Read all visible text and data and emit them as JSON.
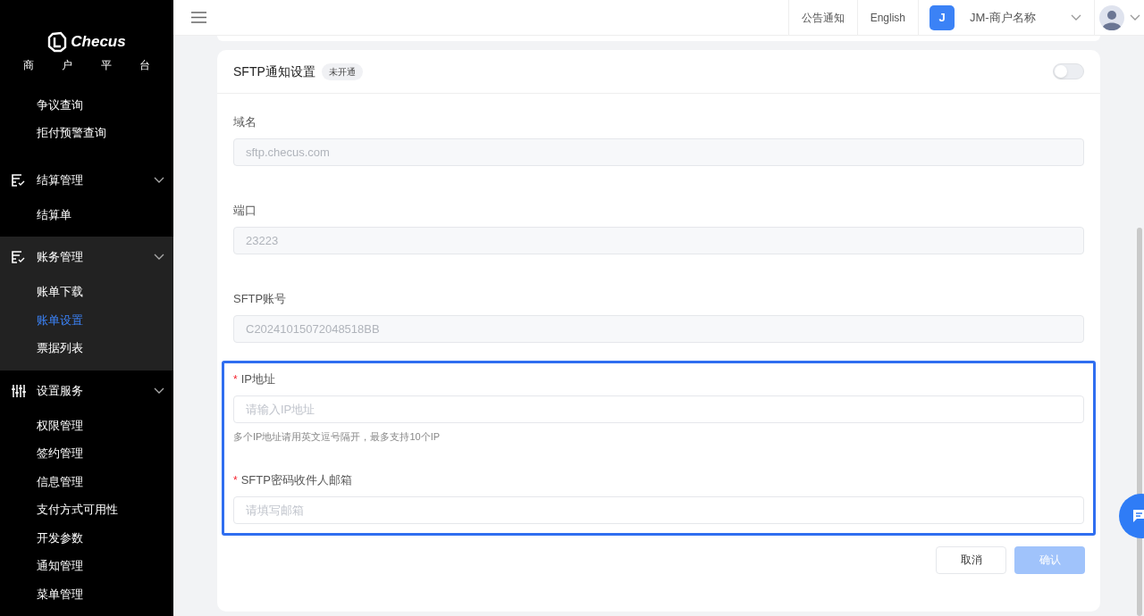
{
  "sidebar": {
    "logo": "Checus",
    "subtitle": "商 户 平 台",
    "top_items": [
      {
        "label": "争议查询",
        "selected": false
      },
      {
        "label": "拒付预警查询",
        "selected": false
      }
    ],
    "groups": [
      {
        "label": "结算管理",
        "kind": "bill",
        "expanded": true,
        "active": false,
        "children": [
          {
            "label": "结算单",
            "selected": false
          }
        ]
      },
      {
        "label": "账务管理",
        "kind": "bill",
        "expanded": true,
        "active": true,
        "children": [
          {
            "label": "账单下载",
            "selected": false
          },
          {
            "label": "账单设置",
            "selected": true
          },
          {
            "label": "票据列表",
            "selected": false
          }
        ]
      },
      {
        "label": "设置服务",
        "kind": "sliders",
        "expanded": true,
        "active": false,
        "children": [
          {
            "label": "权限管理",
            "selected": false
          },
          {
            "label": "签约管理",
            "selected": false
          },
          {
            "label": "信息管理",
            "selected": false
          },
          {
            "label": "支付方式可用性",
            "selected": false
          },
          {
            "label": "开发参数",
            "selected": false
          },
          {
            "label": "通知管理",
            "selected": false
          },
          {
            "label": "菜单管理",
            "selected": false
          }
        ]
      }
    ]
  },
  "header": {
    "notice": "公告通知",
    "language": "English",
    "merchant_initial": "J",
    "merchant_name": "JM-商户名称"
  },
  "card": {
    "title": "SFTP通知设置",
    "badge": "未开通",
    "on": false,
    "fields": [
      {
        "label": "域名",
        "disabled": true,
        "value": "sftp.checus.com"
      },
      {
        "label": "端口",
        "disabled": true,
        "value": "23223"
      },
      {
        "label": "SFTP账号",
        "disabled": true,
        "value": "C20241015072048518BB"
      }
    ],
    "highlighted_fields": [
      {
        "label": "IP地址",
        "required_mark": "*",
        "disabled": false,
        "placeholder": "请输入IP地址",
        "hint": "多个IP地址请用英文逗号隔开，最多支持10个IP"
      },
      {
        "label": "SFTP密码收件人邮箱",
        "required_mark": "*",
        "disabled": false,
        "placeholder": "请填写邮箱"
      }
    ],
    "buttons": [
      {
        "label": "取消",
        "kind": "secondary",
        "disabled": false
      },
      {
        "label": "确认",
        "kind": "primary",
        "disabled": true
      }
    ]
  }
}
